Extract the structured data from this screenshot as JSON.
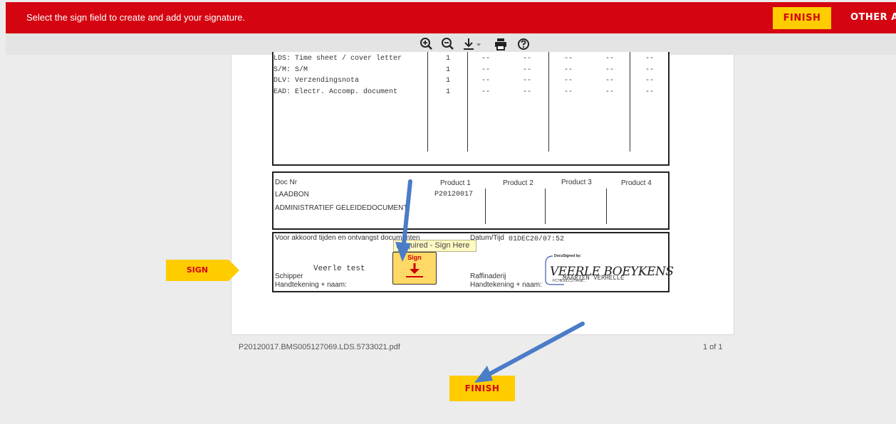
{
  "topbar": {
    "message": "Select the sign field to create and add your signature.",
    "finish_label": "FINISH",
    "other_label": "OTHER AC"
  },
  "toolbar": {
    "icons": [
      "zoom-in-icon",
      "zoom-out-icon",
      "download-icon",
      "print-icon",
      "help-icon"
    ]
  },
  "document": {
    "doc_rows": [
      {
        "name": "LDS: Time sheet / cover letter",
        "count": "1",
        "cols": [
          "--",
          "--",
          "--",
          "--",
          "--"
        ]
      },
      {
        "name": "S/M: S/M",
        "count": "1",
        "cols": [
          "--",
          "--",
          "--",
          "--",
          "--"
        ]
      },
      {
        "name": "DLV: Verzendingsnota",
        "count": "1",
        "cols": [
          "--",
          "--",
          "--",
          "--",
          "--"
        ]
      },
      {
        "name": "EAD: Electr. Accomp. document",
        "count": "1",
        "cols": [
          "--",
          "--",
          "--",
          "--",
          "--"
        ]
      }
    ],
    "products": {
      "doc_nr_label": "Doc Nr",
      "headers": [
        "Product 1",
        "Product 2",
        "Product 3",
        "Product 4"
      ],
      "row1_label": "LAADBON",
      "row1_value": "P20120017",
      "row2_label": "ADMINISTRATIEF GELEIDEDOCUMENT"
    },
    "signatures": {
      "agreement": "Voor akkoord tijden en ontvangst documenten",
      "datetime_label": "Datum/Tijd",
      "datetime_value": "01DEC20/07:52",
      "schipper_name": "Veerle test",
      "schipper": "Schipper",
      "handtekening_left": "Handtekening + naam:",
      "raffinaderij": "Raffinaderij",
      "handtekening_right": "Handtekening + naam:",
      "docusigned_by": "DocuSigned by:",
      "signature_script": "VEERLE BOEYKENS",
      "signature_over": "MAARTEN VERHELLE",
      "signature_id": "FC78D0CC279498..."
    },
    "tooltip": "Required - Sign Here",
    "sign_field_label": "Sign"
  },
  "footer": {
    "filename": "P20120017.BMS005127069.LDS.5733021.pdf",
    "page_count": "1 of 1"
  },
  "side_tag_label": "SIGN",
  "finish_bottom_label": "FINISH",
  "colors": {
    "brand_red": "#d40511",
    "brand_yellow": "#ffcc00",
    "arrow_blue": "#4a7cc8"
  }
}
